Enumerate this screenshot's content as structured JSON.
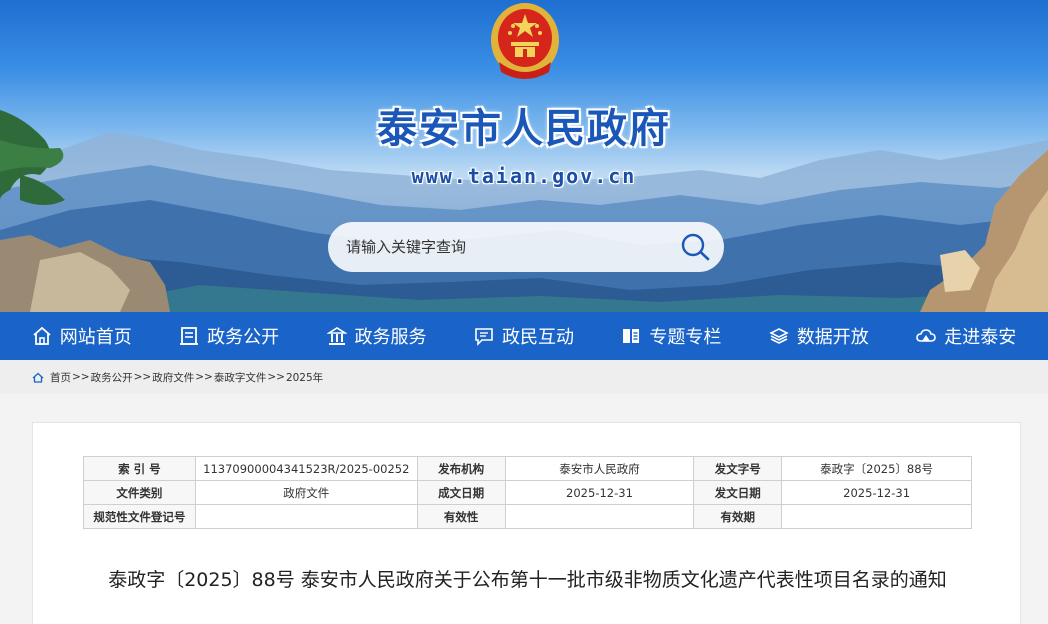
{
  "header": {
    "site_title": "泰安市人民政府",
    "site_url": "www.taian.gov.cn",
    "search_placeholder": "请输入关键字查询"
  },
  "nav": [
    {
      "label": "网站首页",
      "icon": "home-icon"
    },
    {
      "label": "政务公开",
      "icon": "document-icon"
    },
    {
      "label": "政务服务",
      "icon": "government-building-icon"
    },
    {
      "label": "政民互动",
      "icon": "message-icon"
    },
    {
      "label": "专题专栏",
      "icon": "book-icon"
    },
    {
      "label": "数据开放",
      "icon": "layers-icon"
    },
    {
      "label": "走进泰安",
      "icon": "mountain-cloud-icon"
    }
  ],
  "breadcrumb": [
    "首页",
    "政务公开",
    "政府文件",
    "泰政字文件",
    "2025年"
  ],
  "meta_table": {
    "rows": [
      [
        "索 引 号",
        "11370900004341523R/2025-00252",
        "发布机构",
        "泰安市人民政府",
        "发文字号",
        "泰政字〔2025〕88号"
      ],
      [
        "文件类别",
        "政府文件",
        "成文日期",
        "2025-12-31",
        "发文日期",
        "2025-12-31"
      ],
      [
        "规范性文件登记号",
        "",
        "有效性",
        "",
        "有效期",
        ""
      ]
    ]
  },
  "document": {
    "title": "泰政字〔2025〕88号 泰安市人民政府关于公布第十一批市级非物质文化遗产代表性项目名录的通知"
  },
  "colors": {
    "nav_bg": "#1a64c9",
    "title_blue": "#1a57b8",
    "breadcrumb_bg": "#eeeeee"
  }
}
